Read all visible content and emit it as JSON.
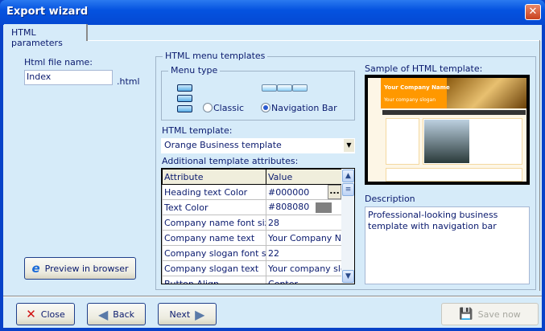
{
  "window": {
    "title": "Export wizard",
    "close_glyph": "✕"
  },
  "tabs": [
    {
      "label": "HTML parameters",
      "active": true
    }
  ],
  "file": {
    "label": "Html file name:",
    "value": "Index",
    "suffix": ".html"
  },
  "preview_button": {
    "label": "Preview in browser"
  },
  "menu_templates": {
    "title": "HTML menu templates",
    "menu_type": {
      "title": "Menu type",
      "options": [
        {
          "label": "Classic",
          "selected": false
        },
        {
          "label": "Navigation Bar",
          "selected": true
        }
      ]
    },
    "template_label": "HTML template:",
    "template_value": "Orange Business template",
    "attributes_label": "Additional template attributes:",
    "attributes": {
      "headers": [
        "Attribute",
        "Value"
      ],
      "rows": [
        {
          "name": "Heading text Color",
          "value": "#000000",
          "swatch": "#000000",
          "edit": "..."
        },
        {
          "name": "Text Color",
          "value": "#808080",
          "swatch": "#808080"
        },
        {
          "name": "Company name font size",
          "value": "28"
        },
        {
          "name": "Company name text",
          "value": "Your Company Name"
        },
        {
          "name": "Company slogan font size",
          "value": "22"
        },
        {
          "name": "Company slogan text",
          "value": "Your company slogan"
        },
        {
          "name": "Button Align",
          "value": "Center"
        }
      ]
    }
  },
  "sample": {
    "label": "Sample of HTML template:",
    "company_name": "Your Company Name",
    "slogan": "Your company slogan"
  },
  "description": {
    "label": "Description",
    "text": "Professional-looking business template with navigation bar"
  },
  "footer": {
    "close": "Close",
    "back": "Back",
    "next": "Next",
    "save": "Save now"
  },
  "colors": {
    "accent": "#ff8c00",
    "background": "#d6ebf9",
    "titlebar": "#0553e0"
  }
}
